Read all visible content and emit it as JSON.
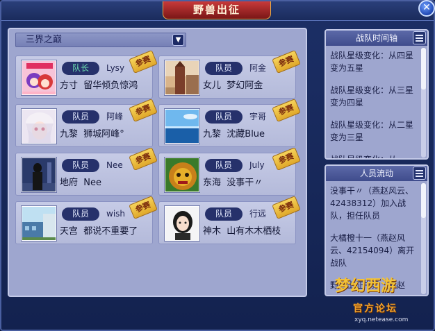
{
  "window": {
    "title": "野兽出征",
    "close_label": "✕"
  },
  "team_selector": {
    "selected": "三界之巅"
  },
  "members": [
    {
      "role": "队长",
      "is_leader": true,
      "nick": "Lysy",
      "server": "方寸",
      "name": "留华倾负惊鸿",
      "badge": "参赛",
      "avatar": "avatar-anime-girls"
    },
    {
      "role": "队员",
      "is_leader": false,
      "nick": "阿金",
      "server": "女儿",
      "name": "梦幻阿金",
      "badge": "参赛",
      "avatar": "avatar-tower"
    },
    {
      "role": "队员",
      "is_leader": false,
      "nick": "阿峰",
      "server": "九黎",
      "name": "狮城阿峰°",
      "badge": "参赛",
      "avatar": "avatar-white-hair"
    },
    {
      "role": "队员",
      "is_leader": false,
      "nick": "宇哥",
      "server": "九黎",
      "name": "沈藏Blue",
      "badge": "参赛",
      "avatar": "avatar-sea"
    },
    {
      "role": "队员",
      "is_leader": false,
      "nick": "Nee",
      "server": "地府",
      "name": "Nee",
      "badge": "参赛",
      "avatar": "avatar-dark-figure"
    },
    {
      "role": "队员",
      "is_leader": false,
      "nick": "July",
      "server": "东海",
      "name": "没事干〃",
      "badge": "参赛",
      "avatar": "avatar-lion"
    },
    {
      "role": "队员",
      "is_leader": false,
      "nick": "wish",
      "server": "天宫",
      "name": "都说不重要了",
      "badge": "参赛",
      "avatar": "avatar-building"
    },
    {
      "role": "队员",
      "is_leader": false,
      "nick": "行远",
      "server": "神木",
      "name": "山有木木栖枝",
      "badge": "参赛",
      "avatar": "avatar-girl-photo"
    }
  ],
  "timeline": {
    "title": "战队时间轴",
    "entries": [
      "战队星级变化：从四星变为五星",
      "战队星级变化：从三星变为四星",
      "战队星级变化：从二星变为三星",
      "战队星级变化：从"
    ]
  },
  "personnel": {
    "title": "人员流动",
    "entries": [
      "没事干〃（燕赵风云、42438312）加入战队，担任队员",
      "大橘橙十一（燕赵风云、42154094）离开战队",
      "野兽出征书柔（燕赵"
    ]
  },
  "watermark": {
    "logo": "梦幻西游",
    "sub": "官方论坛",
    "url": "xyq.netease.com"
  }
}
